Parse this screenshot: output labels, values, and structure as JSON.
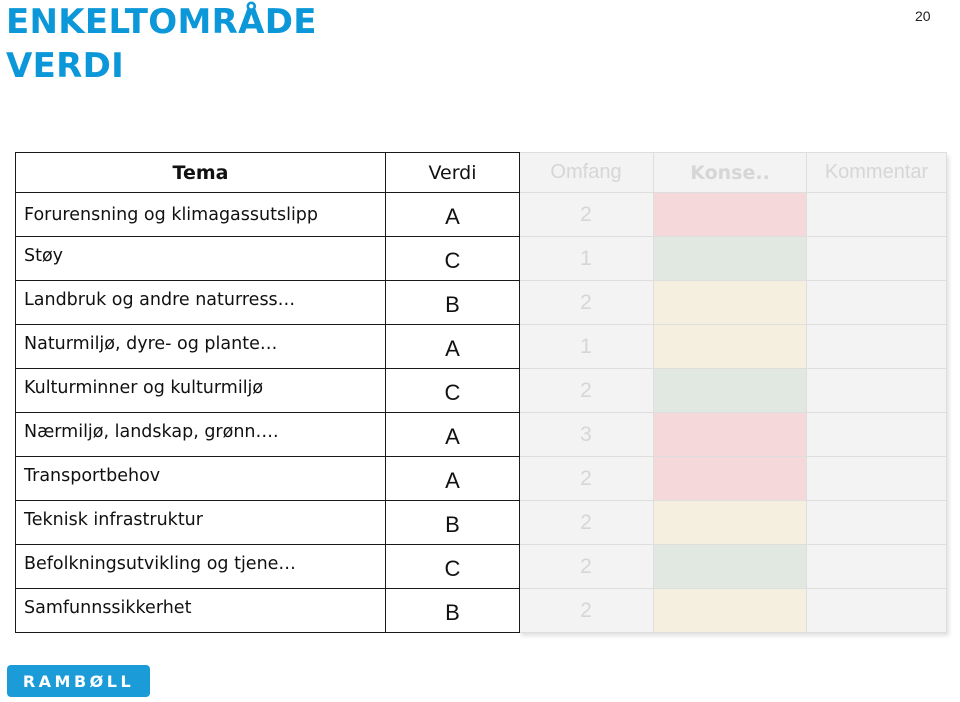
{
  "slide": {
    "title_line1": "ENKELTOMRÅDE",
    "title_line2": "VERDI",
    "page_number": "20"
  },
  "table": {
    "headers": {
      "tema": "Tema",
      "verdi": "Verdi",
      "omfang": "Omfang",
      "konsekvens": "Konse..",
      "kommentar": "Kommentar"
    },
    "rows": [
      {
        "tema": "Forurensning og klimagassutslipp",
        "verdi": "A",
        "omfang": "2",
        "konsekvens_color": "#f5d8da",
        "kommentar": ""
      },
      {
        "tema": "Støy",
        "verdi": "C",
        "omfang": "1",
        "konsekvens_color": "#e1e8e1",
        "kommentar": ""
      },
      {
        "tema": "Landbruk og andre naturress…",
        "verdi": "B",
        "omfang": "2",
        "konsekvens_color": "#f5efdf",
        "kommentar": ""
      },
      {
        "tema": "Naturmiljø, dyre- og plante…",
        "verdi": "A",
        "omfang": "1",
        "konsekvens_color": "#f5efdf",
        "kommentar": ""
      },
      {
        "tema": "Kulturminner og kulturmiljø",
        "verdi": "C",
        "omfang": "2",
        "konsekvens_color": "#e1e8e1",
        "kommentar": ""
      },
      {
        "tema": "Nærmiljø, landskap, grønn….",
        "verdi": "A",
        "omfang": "3",
        "konsekvens_color": "#f5d8da",
        "kommentar": ""
      },
      {
        "tema": "Transportbehov",
        "verdi": "A",
        "omfang": "2",
        "konsekvens_color": "#f5d8da",
        "kommentar": ""
      },
      {
        "tema": "Teknisk infrastruktur",
        "verdi": "B",
        "omfang": "2",
        "konsekvens_color": "#f5efdf",
        "kommentar": ""
      },
      {
        "tema": "Befolkningsutvikling og tjene…",
        "verdi": "C",
        "omfang": "2",
        "konsekvens_color": "#e1e8e1",
        "kommentar": ""
      },
      {
        "tema": "Samfunnssikkerhet",
        "verdi": "B",
        "omfang": "2",
        "konsekvens_color": "#f5efdf",
        "kommentar": ""
      }
    ]
  },
  "logo": {
    "text": "RAMBØLL",
    "color": "#1b9bd7"
  },
  "colors": {
    "title": "#0b97d8"
  }
}
